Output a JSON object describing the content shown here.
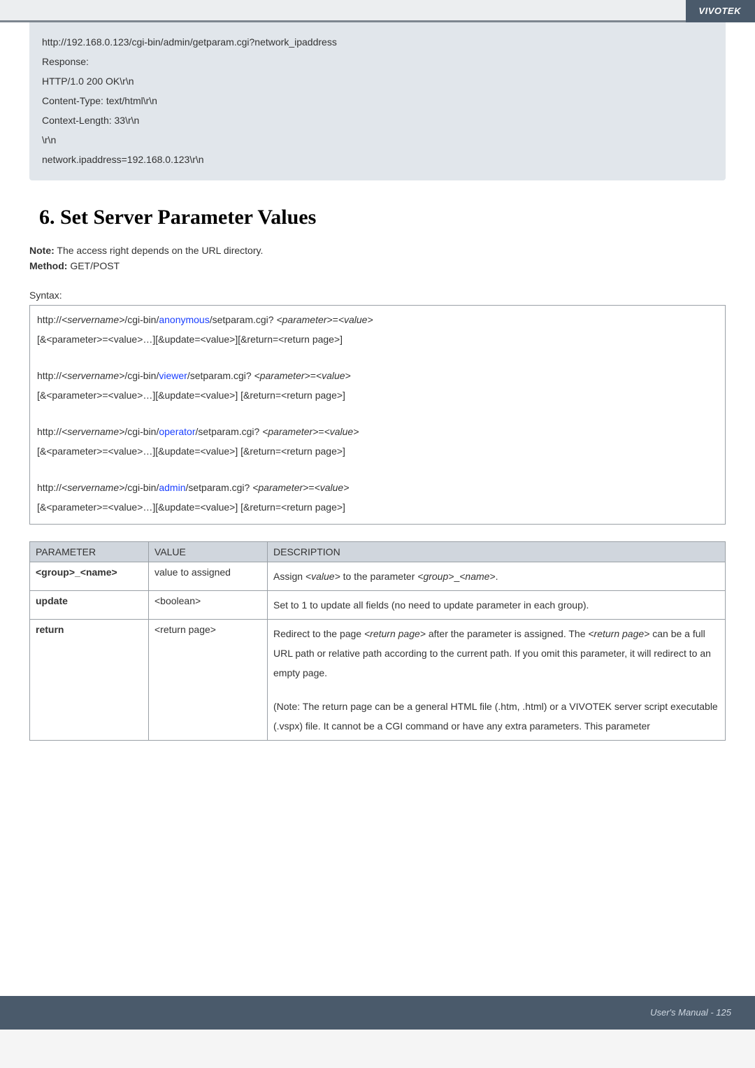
{
  "brand": "VIVOTEK",
  "request": {
    "lines": [
      "http://192.168.0.123/cgi-bin/admin/getparam.cgi?network_ipaddress",
      "",
      "Response:",
      "HTTP/1.0 200 OK\\r\\n",
      "Content-Type: text/html\\r\\n",
      "Context-Length: 33\\r\\n",
      "\\r\\n",
      "network.ipaddress=192.168.0.123\\r\\n"
    ]
  },
  "section": {
    "title": "6. Set Server Parameter Values",
    "note_label": "Note:",
    "note_text": " The access right depends on the URL directory.",
    "method_label": "Method:",
    "method_text": " GET/POST",
    "syntax_label": "Syntax:"
  },
  "syntax": {
    "groups": [
      {
        "pre": "http://",
        "srv": "<servername>",
        "mid1": "/cgi-bin/",
        "role": "anonymous",
        "mid2": "/setparam.cgi? ",
        "param": "<parameter>",
        "eq": "=",
        "val": "<value>",
        "line2": "[&<parameter>=<value>…][&update=<value>][&return=<return page>]"
      },
      {
        "pre": "http://",
        "srv": "<servername>",
        "mid1": "/cgi-bin/",
        "role": "viewer",
        "mid2": "/setparam.cgi? ",
        "param": "<parameter>",
        "eq": "=",
        "val": "<value>",
        "line2": "[&<parameter>=<value>…][&update=<value>] [&return=<return page>]"
      },
      {
        "pre": "http://",
        "srv": "<servername>",
        "mid1": "/cgi-bin/",
        "role": "operator",
        "mid2": "/setparam.cgi? ",
        "param": "<parameter>",
        "eq": "=",
        "val": "<value>",
        "line2": "[&<parameter>=<value>…][&update=<value>] [&return=<return page>]"
      },
      {
        "pre": "http://",
        "srv": "<servername>",
        "mid1": "/cgi-bin/",
        "role": "admin",
        "mid2": "/setparam.cgi? ",
        "param": "<parameter>",
        "eq": "=",
        "val": "<value>",
        "line2": "[&<parameter>=<value>…][&update=<value>] [&return=<return page>]"
      }
    ]
  },
  "table": {
    "header": {
      "c1": "PARAMETER",
      "c2": "VALUE",
      "c3": "DESCRIPTION"
    },
    "row1": {
      "param": "<group>_<name>",
      "value": "value to assigned",
      "d1": "Assign ",
      "d2": "<value>",
      "d3": " to the parameter ",
      "d4": "<group>",
      "d5": "_",
      "d6": "<name>",
      "d7": "."
    },
    "row2": {
      "param": "update",
      "value": "<boolean>",
      "desc": "Set to 1 to update all fields (no need to update parameter in each group)."
    },
    "row3": {
      "param": "return",
      "value": "<return page>",
      "d1": "Redirect to the page ",
      "d2": "<return page>",
      "d3": " after the parameter is assigned. The ",
      "d4": "<return page>",
      "d5": " can be a full URL path or relative path according to the current path. If you omit this parameter, it will redirect to an empty page.",
      "gapnote": "(Note: The return page can be a general HTML file (.htm, .html) or a VIVOTEK server script executable (.vspx) file. It cannot be a CGI command or have any extra parameters. This parameter"
    }
  },
  "footer": "User's Manual - 125"
}
